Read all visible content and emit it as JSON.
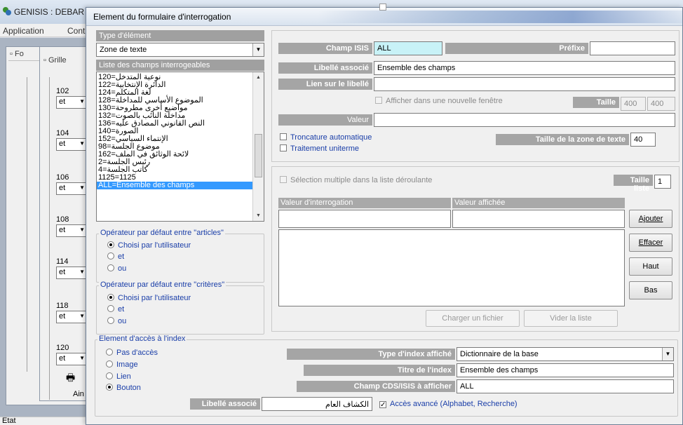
{
  "background": {
    "app_title": "GENISIS : DEBAR",
    "menu": [
      "Application",
      "Cont"
    ],
    "child_windows": [
      "Fo",
      "Grille"
    ],
    "row_numbers": [
      "102",
      "104",
      "106",
      "108",
      "114",
      "118",
      "120"
    ],
    "row_operator": "et",
    "ainsi_label": "Ain",
    "status": "Etat"
  },
  "dialog": {
    "title": "Element du formulaire d'interrogation",
    "type_section": "Type d'élément",
    "type_value": "Zone de texte",
    "fields_section": "Liste des champs interrogeables",
    "fields": [
      "نوعية المتدخل=120",
      "الدائرة الإنتخابية=122",
      "لغة المتكلم=124",
      "الموضوع الأساسي للمداخلة=128",
      "مواضيع أخرى مطروحة=130",
      "مداخلة النائب بالصوت=132",
      "النص القانوني المصادق عليه=136",
      "الصورة=140",
      "الإنتماء السياسي=152",
      "موضوع الجلسة=98",
      "لائحة الوثائق في الملف=162",
      "رئيس الجلسة=2",
      "كاتب الجلسة=4",
      "1125=1125",
      "ALL=Ensemble des champs"
    ],
    "selected_field_index": 14,
    "op_articles": {
      "label": "Opérateur par défaut entre \"articles\"",
      "options": [
        "Choisi par l'utilisateur",
        "et",
        "ou"
      ],
      "selected": 0
    },
    "op_criteres": {
      "label": "Opérateur par défaut entre \"critères\"",
      "options": [
        "Choisi par l'utilisateur",
        "et",
        "ou"
      ],
      "selected": 0
    },
    "champ_isis_label": "Champ ISIS",
    "champ_isis_value": "ALL",
    "prefixe_label": "Préfixe",
    "prefixe_value": "",
    "libelle_label": "Libellé associé",
    "libelle_value": "Ensemble des champs",
    "lien_label": "Lien sur le libellé",
    "lien_value": "",
    "nouvelle_fenetre_label": "Afficher dans une nouvelle fenêtre",
    "taille_label": "Taille",
    "taille_w": "400",
    "taille_h": "400",
    "valeur_label": "Valeur",
    "valeur_value": "",
    "troncature_label": "Troncature automatique",
    "uniterme_label": "Traitement uniterme",
    "taille_zone_label": "Taille de la zone de texte",
    "taille_zone_value": "40",
    "selection_multiple_label": "Sélection multiple dans la liste déroulante",
    "taille_liste_label": "Taille liste",
    "taille_liste_value": "1",
    "col_interrogation": "Valeur d'interrogation",
    "col_affichee": "Valeur affichée",
    "btn_ajouter": "Ajouter",
    "btn_effacer": "Effacer",
    "btn_haut": "Haut",
    "btn_bas": "Bas",
    "btn_charger": "Charger un fichier",
    "btn_vider": "Vider la liste",
    "index_section": "Element d'accès à l'index",
    "index_options": [
      "Pas d'accès",
      "Image",
      "Lien",
      "Bouton"
    ],
    "index_selected": 3,
    "type_index_label": "Type d'index affiché",
    "type_index_value": "Dictionnaire de la base",
    "titre_index_label": "Titre de l'index",
    "titre_index_value": "Ensemble des champs",
    "champ_cds_label": "Champ CDS/ISIS à afficher",
    "champ_cds_value": "ALL",
    "libelle_assoc2_label": "Libellé associé",
    "libelle_assoc2_value": "الكشاف العام",
    "acces_avance_label": "Accès avancé (Alphabet, Recherche)",
    "acces_avance_checked": true
  },
  "colors": {
    "label_bar": "#a5a5a5",
    "selection": "#3399ff",
    "group_label": "#1a3ea8",
    "cyan_field": "#c8f2f7"
  }
}
